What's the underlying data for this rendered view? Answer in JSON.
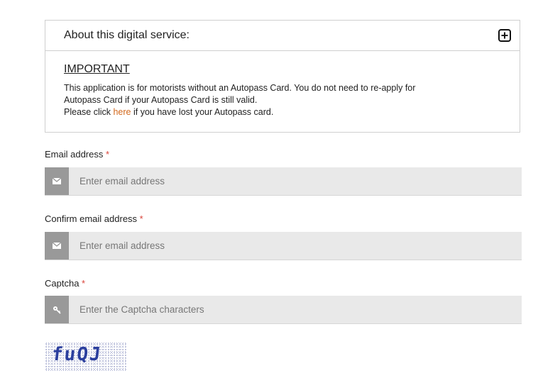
{
  "about": {
    "title": "About this digital service:",
    "important_heading": "IMPORTANT",
    "text_line_1": "This application is for motorists without an Autopass Card. You do not need to re-apply for",
    "text_line_2": "Autopass Card if your Autopass Card is still valid.",
    "text_line_3_before": "Please click ",
    "text_line_3_link": "here",
    "text_line_3_after": " if you have lost your Autopass card."
  },
  "form": {
    "required_marker": "*",
    "email": {
      "label": "Email address",
      "placeholder": "Enter email address",
      "icon": "envelope-icon"
    },
    "confirm_email": {
      "label": "Confirm email address",
      "placeholder": "Enter email address",
      "icon": "envelope-icon"
    },
    "captcha": {
      "label": "Captcha",
      "placeholder": "Enter the Captcha characters",
      "icon": "key-icon",
      "image_text": "fuQJ"
    }
  },
  "colors": {
    "link": "#d2691e",
    "required": "#d9443a",
    "icon_bg": "#999999",
    "input_bg": "#e9e9e9",
    "captcha_text": "#2b3f9e"
  }
}
